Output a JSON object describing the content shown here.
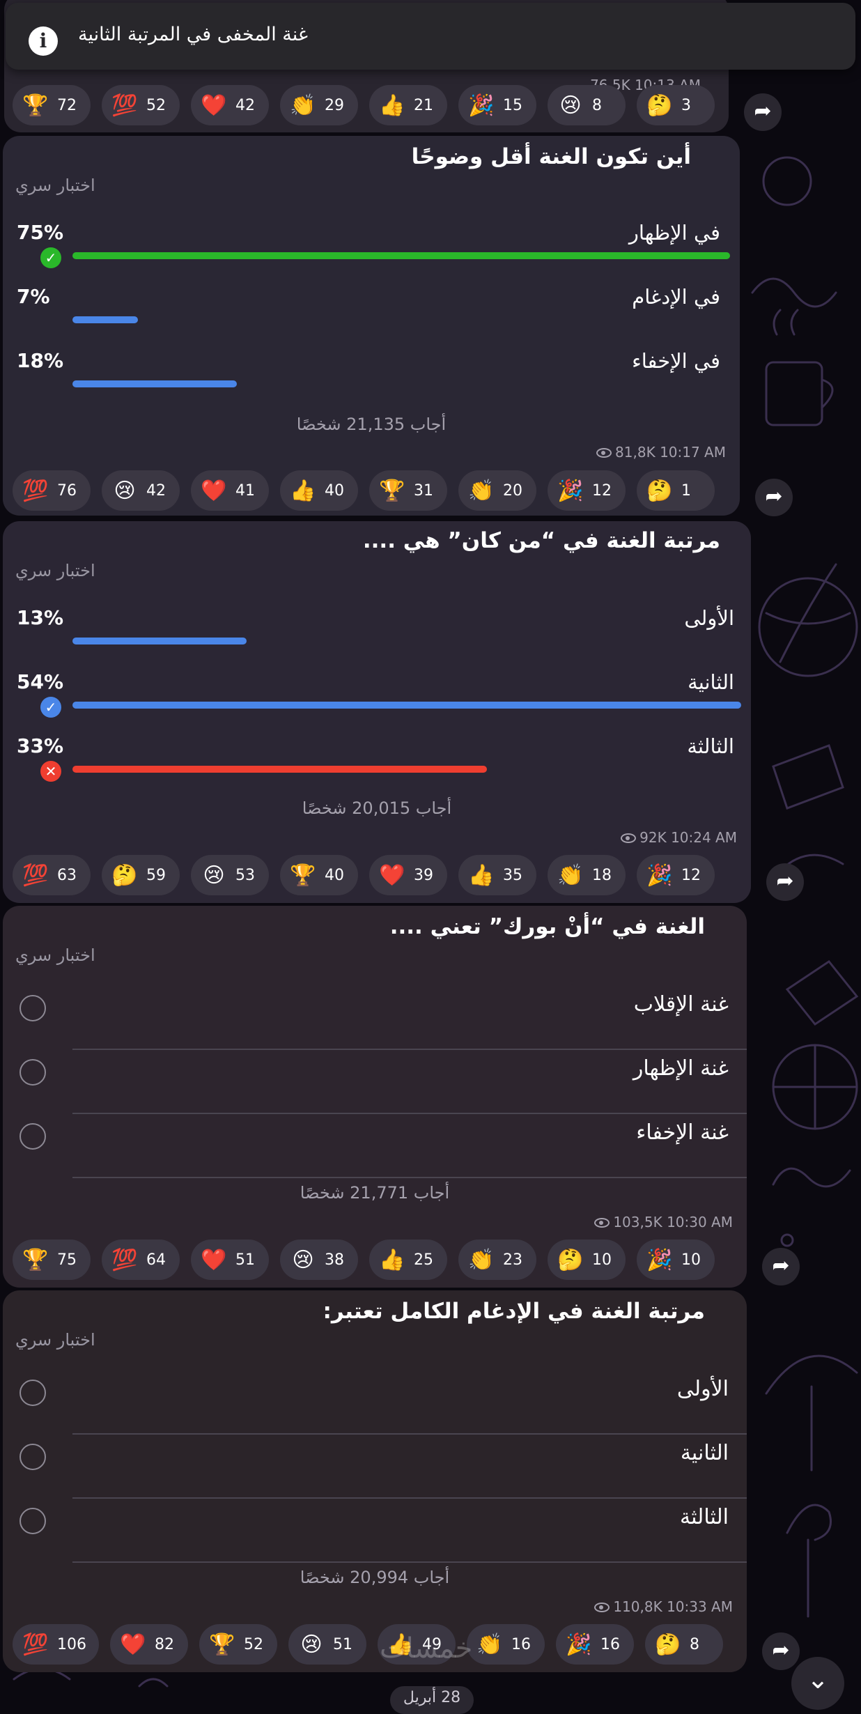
{
  "tooltip": {
    "text": "غنة المخفى في المرتبة الثانية",
    "icon": "info-icon"
  },
  "top_bubble": {
    "meta": "76,5K 10:13 AM",
    "reactions": [
      {
        "emoji": "🏆",
        "count": "72"
      },
      {
        "emoji": "💯",
        "count": "52"
      },
      {
        "emoji": "❤️",
        "count": "42"
      },
      {
        "emoji": "👏",
        "count": "29"
      },
      {
        "emoji": "👍",
        "count": "21"
      },
      {
        "emoji": "🎉",
        "count": "15"
      },
      {
        "emoji": "😢",
        "count": "8"
      },
      {
        "emoji": "🤔",
        "count": "3"
      }
    ]
  },
  "polls": [
    {
      "question": "أين تكون الغنة أقل وضوحًا",
      "type": "اختبار سري",
      "options": [
        {
          "text": "في الإظهار",
          "percent": "75%",
          "fraction": 1.0,
          "color": "#2ab82a",
          "mark": "check",
          "mark_color": "#2ab82a"
        },
        {
          "text": "في الإدغام",
          "percent": "7%",
          "fraction": 0.1,
          "color": "#4a86e8"
        },
        {
          "text": "في الإخفاء",
          "percent": "18%",
          "fraction": 0.25,
          "color": "#4a86e8"
        }
      ],
      "voters": "أجاب 21,135 شخصًا",
      "views": "81,8K",
      "time": "10:17 AM",
      "reactions": [
        {
          "emoji": "💯",
          "count": "76"
        },
        {
          "emoji": "😢",
          "count": "42"
        },
        {
          "emoji": "❤️",
          "count": "41"
        },
        {
          "emoji": "👍",
          "count": "40"
        },
        {
          "emoji": "🏆",
          "count": "31"
        },
        {
          "emoji": "👏",
          "count": "20"
        },
        {
          "emoji": "🎉",
          "count": "12"
        },
        {
          "emoji": "🤔",
          "count": "1"
        }
      ]
    },
    {
      "question": "مرتبة الغنة في “من كان” هي ....",
      "type": "اختبار سري",
      "options": [
        {
          "text": "الأولى",
          "percent": "13%",
          "fraction": 0.26,
          "color": "#4a86e8"
        },
        {
          "text": "الثانية",
          "percent": "54%",
          "fraction": 1.0,
          "color": "#4a86e8",
          "mark": "check",
          "mark_color": "#4a86e8"
        },
        {
          "text": "الثالثة",
          "percent": "33%",
          "fraction": 0.62,
          "color": "#ef3e30",
          "mark": "cross",
          "mark_color": "#ef3e30"
        }
      ],
      "voters": "أجاب 20,015 شخصًا",
      "views": "92K",
      "time": "10:24 AM",
      "reactions": [
        {
          "emoji": "💯",
          "count": "63"
        },
        {
          "emoji": "🤔",
          "count": "59"
        },
        {
          "emoji": "😢",
          "count": "53"
        },
        {
          "emoji": "🏆",
          "count": "40"
        },
        {
          "emoji": "❤️",
          "count": "39"
        },
        {
          "emoji": "👍",
          "count": "35"
        },
        {
          "emoji": "👏",
          "count": "18"
        },
        {
          "emoji": "🎉",
          "count": "12"
        }
      ]
    },
    {
      "question": "الغنة في “أنْ بورك” تعني ....",
      "type": "اختبار سري",
      "options": [
        {
          "text": "غنة الإقلاب"
        },
        {
          "text": "غنة الإظهار"
        },
        {
          "text": "غنة الإخفاء"
        }
      ],
      "voters": "أجاب 21,771 شخصًا",
      "views": "103,5K",
      "time": "10:30 AM",
      "reactions": [
        {
          "emoji": "🏆",
          "count": "75"
        },
        {
          "emoji": "💯",
          "count": "64"
        },
        {
          "emoji": "❤️",
          "count": "51"
        },
        {
          "emoji": "😢",
          "count": "38"
        },
        {
          "emoji": "👍",
          "count": "25"
        },
        {
          "emoji": "👏",
          "count": "23"
        },
        {
          "emoji": "🤔",
          "count": "10"
        },
        {
          "emoji": "🎉",
          "count": "10"
        }
      ]
    },
    {
      "question": "مرتبة الغنة في الإدغام الكامل تعتبر:",
      "type": "اختبار سري",
      "options": [
        {
          "text": "الأولى"
        },
        {
          "text": "الثانية"
        },
        {
          "text": "الثالثة"
        }
      ],
      "voters": "أجاب 20,994 شخصًا",
      "views": "110,8K",
      "time": "10:33 AM",
      "reactions": [
        {
          "emoji": "💯",
          "count": "106"
        },
        {
          "emoji": "❤️",
          "count": "82"
        },
        {
          "emoji": "🏆",
          "count": "52"
        },
        {
          "emoji": "😢",
          "count": "51"
        },
        {
          "emoji": "👍",
          "count": "49"
        },
        {
          "emoji": "👏",
          "count": "16"
        },
        {
          "emoji": "🎉",
          "count": "16"
        },
        {
          "emoji": "🤔",
          "count": "8"
        }
      ]
    }
  ],
  "date_pill": "28 أبريل",
  "watermark": "خمسات"
}
